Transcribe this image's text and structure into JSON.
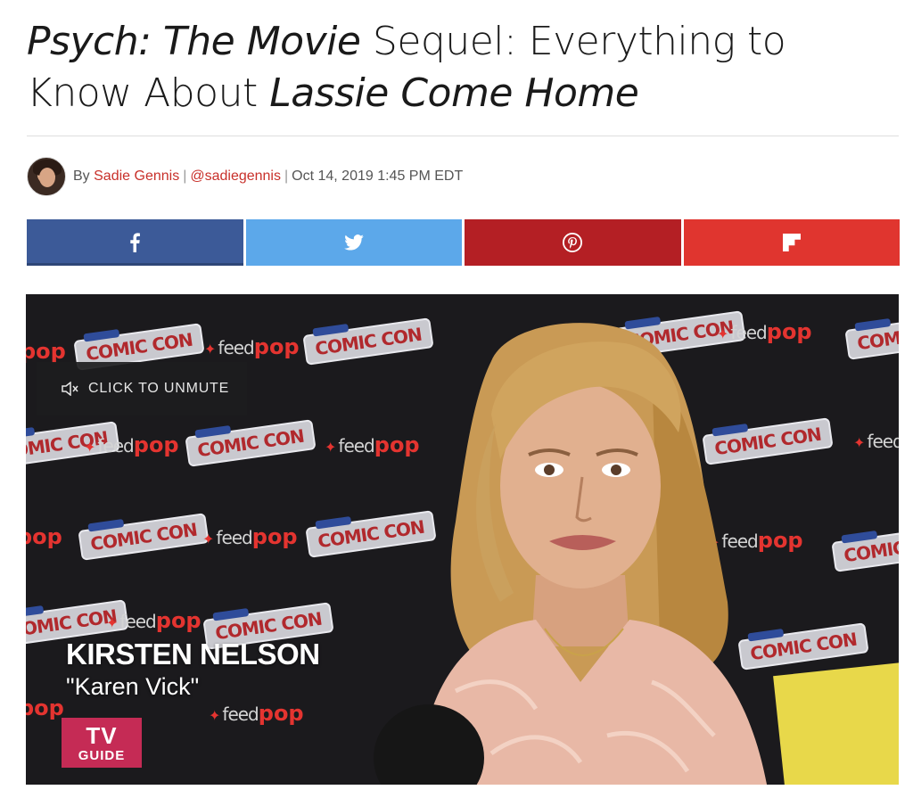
{
  "article": {
    "headline_part1": "Psych: The Movie",
    "headline_part2": " Sequel: Everything to Know About ",
    "headline_part3": "Lassie Come Home"
  },
  "byline": {
    "prefix": "By ",
    "author": "Sadie Gennis",
    "separator": "|",
    "handle": "@sadiegennis",
    "datetime": "Oct 14, 2019 1:45 PM EDT"
  },
  "share": {
    "buttons": [
      {
        "network": "facebook",
        "icon": "facebook-icon",
        "color": "#3c5a98"
      },
      {
        "network": "twitter",
        "icon": "twitter-icon",
        "color": "#5ca8ea"
      },
      {
        "network": "pinterest",
        "icon": "pinterest-icon",
        "color": "#b41f24"
      },
      {
        "network": "flipboard",
        "icon": "flipboard-icon",
        "color": "#e0352f"
      }
    ]
  },
  "video": {
    "unmute_label": "CLICK TO UNMUTE",
    "unmute_icon": "speaker-muted-icon",
    "lower_third_name": "KIRSTEN NELSON",
    "lower_third_role": "\"Karen Vick\"",
    "brand_tv": "TV",
    "brand_guide": "GUIDE",
    "backdrop_logo_comiccon": "COMIC CON",
    "backdrop_logo_feed": "feed",
    "backdrop_logo_pop": "pop"
  }
}
